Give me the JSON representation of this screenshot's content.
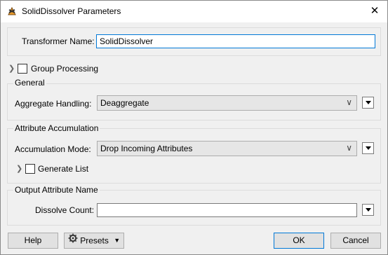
{
  "window": {
    "title": "SolidDissolver Parameters",
    "close_glyph": "✕"
  },
  "transformer": {
    "label": "Transformer Name:",
    "value": "SolidDissolver"
  },
  "group_processing": {
    "label": "Group Processing",
    "checked": false
  },
  "general": {
    "title": "General",
    "aggregate_label": "Aggregate Handling:",
    "aggregate_value": "Deaggregate"
  },
  "attribute_accumulation": {
    "title": "Attribute Accumulation",
    "mode_label": "Accumulation Mode:",
    "mode_value": "Drop Incoming Attributes",
    "generate_list_label": "Generate List"
  },
  "output": {
    "title": "Output Attribute Name",
    "dissolve_label": "Dissolve Count:",
    "dissolve_value": ""
  },
  "buttons": {
    "help": "Help",
    "presets": "Presets",
    "ok": "OK",
    "cancel": "Cancel"
  },
  "icons": {
    "app": "solid-dissolver-icon",
    "gear": "gear-icon",
    "chevron": "chevron-down-icon"
  },
  "colors": {
    "focus_border": "#0078d7",
    "window_bg": "#f0f0f0"
  }
}
